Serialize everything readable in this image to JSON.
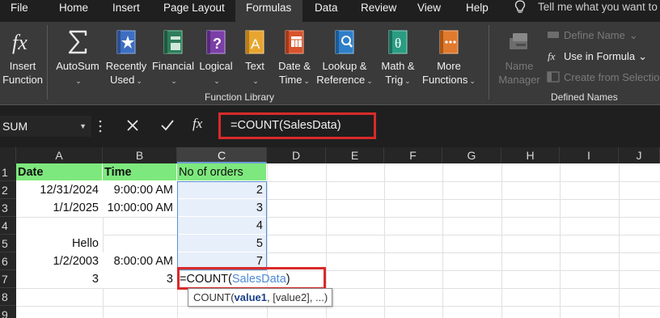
{
  "menu": {
    "tabs": [
      "File",
      "Home",
      "Insert",
      "Page Layout",
      "Formulas",
      "Data",
      "Review",
      "View",
      "Help"
    ],
    "active": "Formulas",
    "tell_me": "Tell me what you want to"
  },
  "ribbon": {
    "function_library": {
      "label": "Function Library",
      "buttons": [
        {
          "line1": "Insert",
          "line2": "Function",
          "icon": "insert-function-icon"
        },
        {
          "line1": "AutoSum",
          "line2": "",
          "caret": true,
          "icon": "sigma-icon"
        },
        {
          "line1": "Recently",
          "line2": "Used",
          "caret": true,
          "icon": "star-book-icon"
        },
        {
          "line1": "Financial",
          "line2": "",
          "caret": true,
          "icon": "financial-book-icon"
        },
        {
          "line1": "Logical",
          "line2": "",
          "caret": true,
          "icon": "question-book-icon"
        },
        {
          "line1": "Text",
          "line2": "",
          "caret": true,
          "icon": "text-book-icon"
        },
        {
          "line1": "Date &",
          "line2": "Time",
          "caret": true,
          "icon": "calendar-book-icon"
        },
        {
          "line1": "Lookup &",
          "line2": "Reference",
          "caret": true,
          "icon": "lookup-book-icon"
        },
        {
          "line1": "Math &",
          "line2": "Trig",
          "caret": true,
          "icon": "theta-book-icon"
        },
        {
          "line1": "More",
          "line2": "Functions",
          "caret": true,
          "icon": "more-functions-icon"
        }
      ]
    },
    "defined_names": {
      "label": "Defined Names",
      "name_manager": {
        "line1": "Name",
        "line2": "Manager"
      },
      "define_name": "Define Name",
      "use_in_formula": "Use in Formula",
      "create_from_selection": "Create from Selection"
    }
  },
  "formula_bar": {
    "name_box": "SUM",
    "fx": "fx",
    "formula": "=COUNT(SalesData)"
  },
  "grid": {
    "columns": [
      "A",
      "B",
      "C",
      "D",
      "E",
      "F",
      "G",
      "H",
      "I",
      "J"
    ],
    "selected_column": "C",
    "rows": [
      "1",
      "2",
      "3",
      "4",
      "5",
      "6",
      "7",
      "8",
      "9"
    ],
    "cells": {
      "A1": "Date",
      "B1": "Time",
      "C1": "No of orders",
      "A2": "12/31/2024",
      "B2": "9:00:00 AM",
      "C2": "2",
      "A3": "1/1/2025",
      "B3": "10:00:00 AM",
      "C3": "3",
      "C4": "4",
      "A5": "Hello",
      "C5": "5",
      "A6": "1/2/2003",
      "B6": "8:00:00 AM",
      "C6": "7",
      "A7": "3",
      "B7": "3"
    },
    "edit_cell": {
      "prefix": "=COUNT(",
      "ref": "SalesData",
      "suffix": ")"
    },
    "tooltip": {
      "fn": "COUNT(",
      "arg1": "value1",
      "rest": ", [value2], ...)"
    }
  },
  "colors": {
    "header_fill": "#7de87d",
    "highlight_red": "#d92a2a",
    "range_blue": "#5b8fd2",
    "ribbon_bg": "#3a3a3a"
  }
}
